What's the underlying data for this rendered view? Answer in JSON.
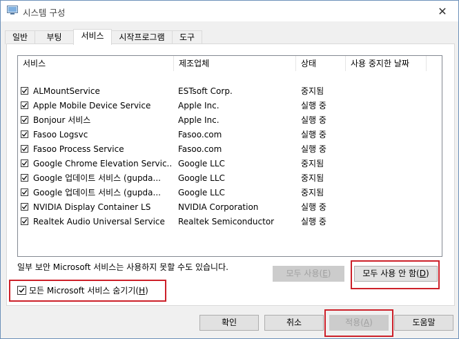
{
  "window": {
    "title": "시스템 구성",
    "close_glyph": "✕"
  },
  "tabs": [
    {
      "label": "일반"
    },
    {
      "label": "부팅"
    },
    {
      "label": "서비스"
    },
    {
      "label": "시작프로그램"
    },
    {
      "label": "도구"
    }
  ],
  "columns": {
    "service": "서비스",
    "maker": "제조업체",
    "status": "상태",
    "disabled_date": "사용 중지한 날짜"
  },
  "services": [
    {
      "name": "ALMountService",
      "maker": "ESTsoft Corp.",
      "status": "중지됨"
    },
    {
      "name": "Apple Mobile Device Service",
      "maker": "Apple Inc.",
      "status": "실행 중"
    },
    {
      "name": "Bonjour 서비스",
      "maker": "Apple Inc.",
      "status": "실행 중"
    },
    {
      "name": "Fasoo Logsvc",
      "maker": "Fasoo.com",
      "status": "실행 중"
    },
    {
      "name": "Fasoo Process Service",
      "maker": "Fasoo.com",
      "status": "실행 중"
    },
    {
      "name": "Google Chrome Elevation Servic...",
      "maker": "Google LLC",
      "status": "중지됨"
    },
    {
      "name": "Google 업데이트 서비스 (gupda...",
      "maker": "Google LLC",
      "status": "중지됨"
    },
    {
      "name": "Google 업데이트 서비스 (gupda...",
      "maker": "Google LLC",
      "status": "중지됨"
    },
    {
      "name": "NVIDIA Display Container LS",
      "maker": "NVIDIA Corporation",
      "status": "실행 중"
    },
    {
      "name": "Realtek Audio Universal Service",
      "maker": "Realtek Semiconductor",
      "status": "실행 중"
    }
  ],
  "note": "일부 보안 Microsoft 서비스는 사용하지 못할 수도 있습니다.",
  "buttons": {
    "enable_all": {
      "text": "모두 사용(",
      "key": "E",
      "end": ")"
    },
    "disable_all": {
      "text": "모두 사용 안 함(",
      "key": "D",
      "end": ")"
    },
    "ok": "확인",
    "cancel": "취소",
    "apply": {
      "text": "적용(",
      "key": "A",
      "end": ")"
    },
    "help": "도움말"
  },
  "hide_ms": {
    "text": "모든 Microsoft 서비스 숨기기(",
    "key": "H",
    "end": ")"
  },
  "colors": {
    "highlight": "#cc1f28",
    "accent": "#0078d7"
  }
}
